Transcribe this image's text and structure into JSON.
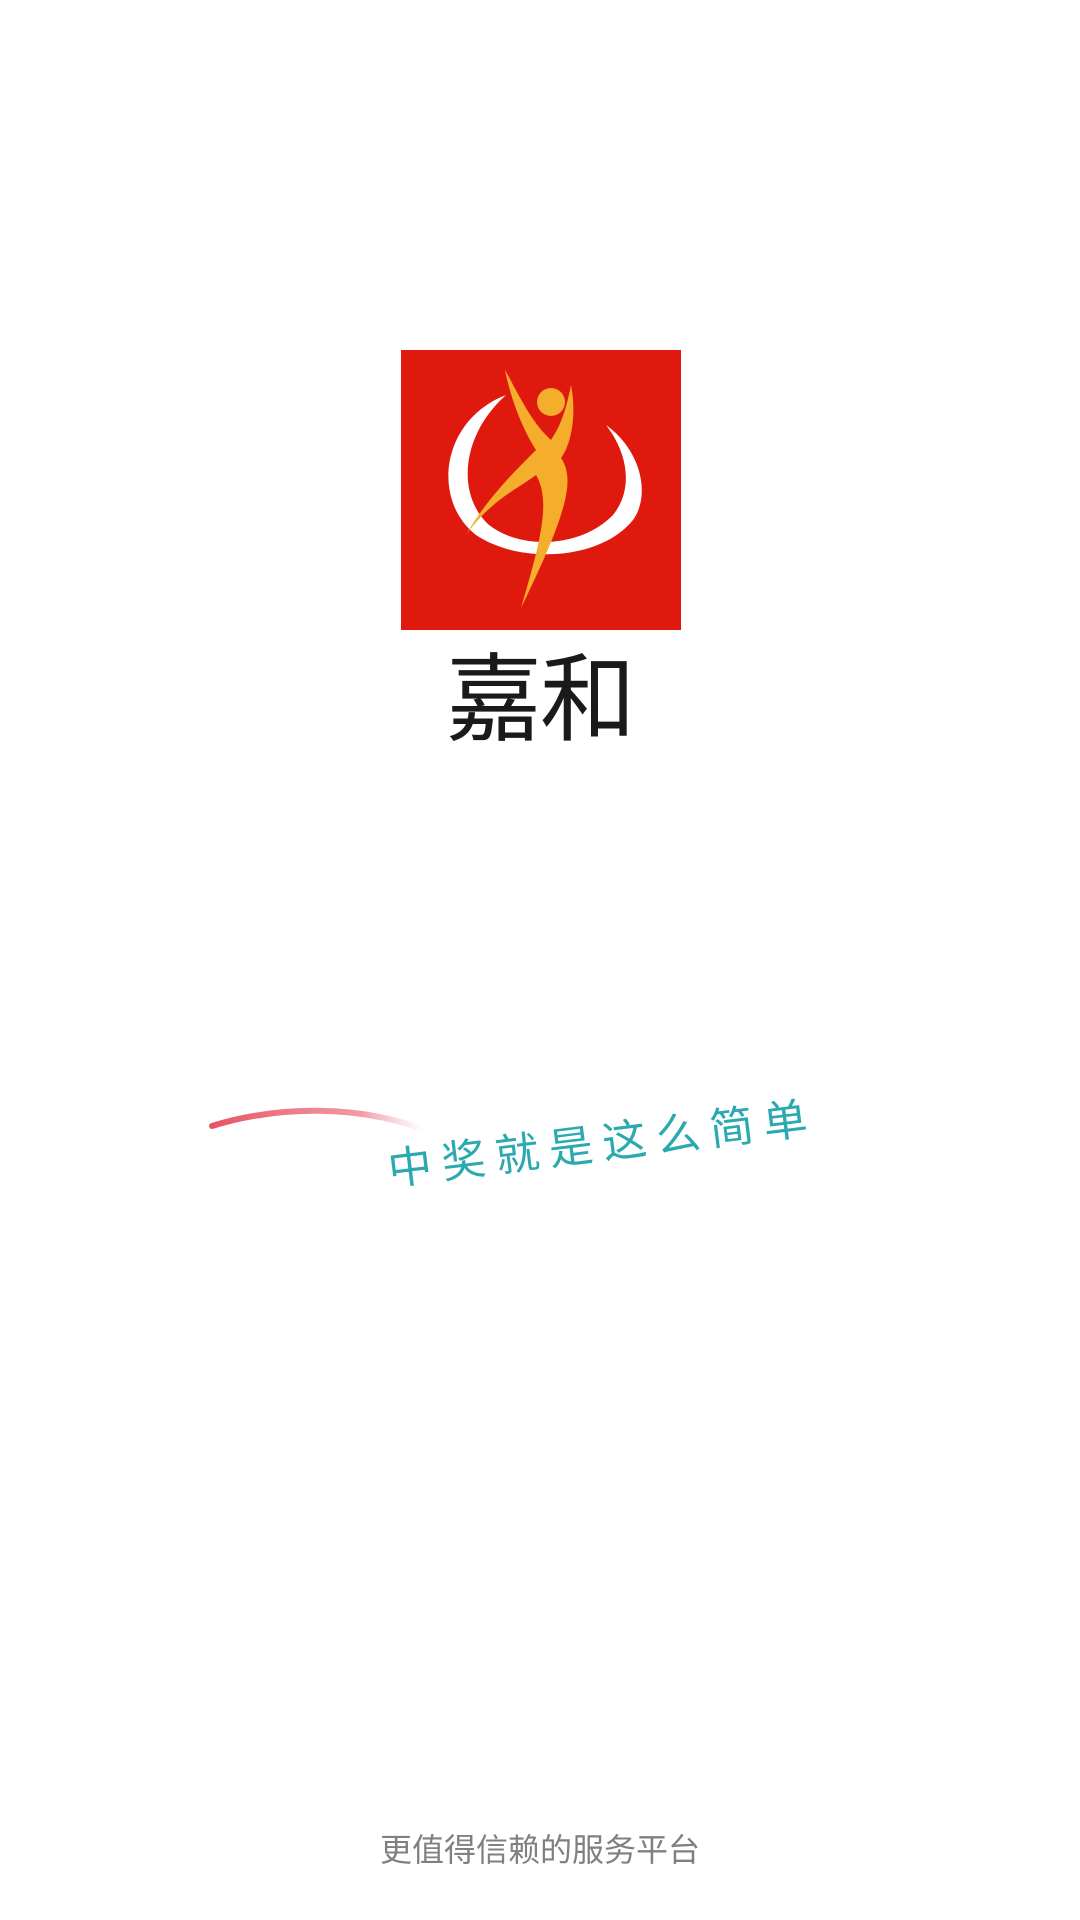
{
  "splash": {
    "logo_icon": "jiahe-logo-icon",
    "brand_color": "#e0190f",
    "accent_color": "#f5ae2c",
    "app_name": "嘉和",
    "slogan": "中奖就是这么简单",
    "slogan_color": "#2aaab0",
    "footer_text": "更值得信赖的服务平台"
  }
}
